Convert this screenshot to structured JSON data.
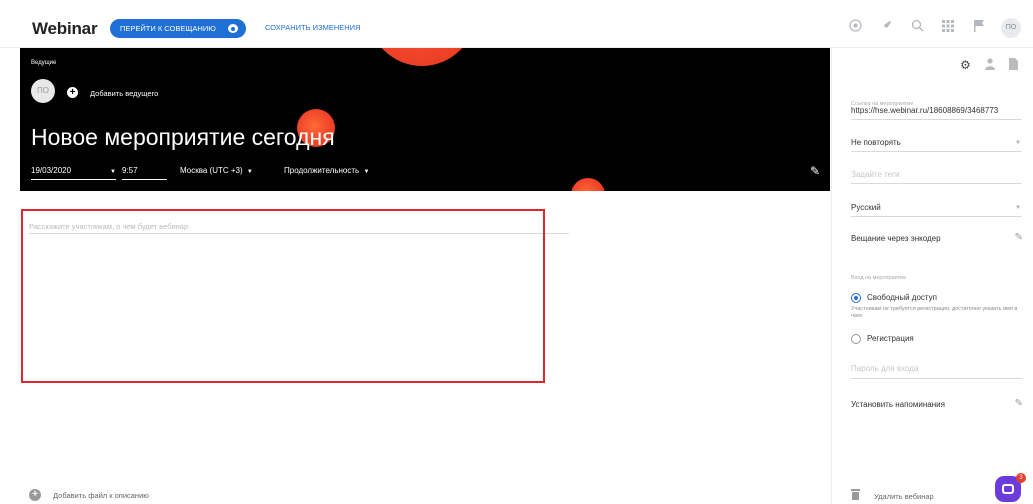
{
  "topbar": {
    "logo": "Webinar",
    "join_button": "ПЕРЕЙТИ К СОВЕЩАНИЮ",
    "save_link": "СОХРАНИТЬ ИЗМЕНЕНИЯ",
    "user_initials": "ПО",
    "icons": [
      "help-icon",
      "rocket-icon",
      "search-icon",
      "apps-grid-icon",
      "flag-icon"
    ]
  },
  "hero": {
    "hosts_label": "Ведущие",
    "host_initials": "ПО",
    "add_host": "Добавить ведущего",
    "title": "Новое мероприятие сегодня",
    "date": "19/03/2020",
    "time": "9:57",
    "timezone": "Москва (UTC +3)",
    "duration": "Продолжительность"
  },
  "main": {
    "description_placeholder": "Расскажите участникам, о чем будет вебинар",
    "add_file": "Добавить файл к описанию"
  },
  "right_panel": {
    "link_label": "Ссылка на мероприятие",
    "link_value": "https://hse.webinar.ru/18608869/3468773",
    "repeat_value": "Не повторять",
    "tags_placeholder": "Задайте теги",
    "language_value": "Русский",
    "encoder": "Вещание через энкодер",
    "access_label": "Вход на мероприятие",
    "free_access": "Свободный доступ",
    "free_access_help": "Участникам не требуется регистрация, достаточно указать имя в чате",
    "registration": "Регистрация",
    "password_placeholder": "Пароль для входа",
    "reminders": "Установить напоминания",
    "delete": "Удалить вебинар"
  },
  "chat": {
    "badge": "3"
  },
  "colors": {
    "accent": "#1f6fd6",
    "highlight": "#e0262b",
    "blob": "#f0442a",
    "chat": "#6c3bdc"
  }
}
